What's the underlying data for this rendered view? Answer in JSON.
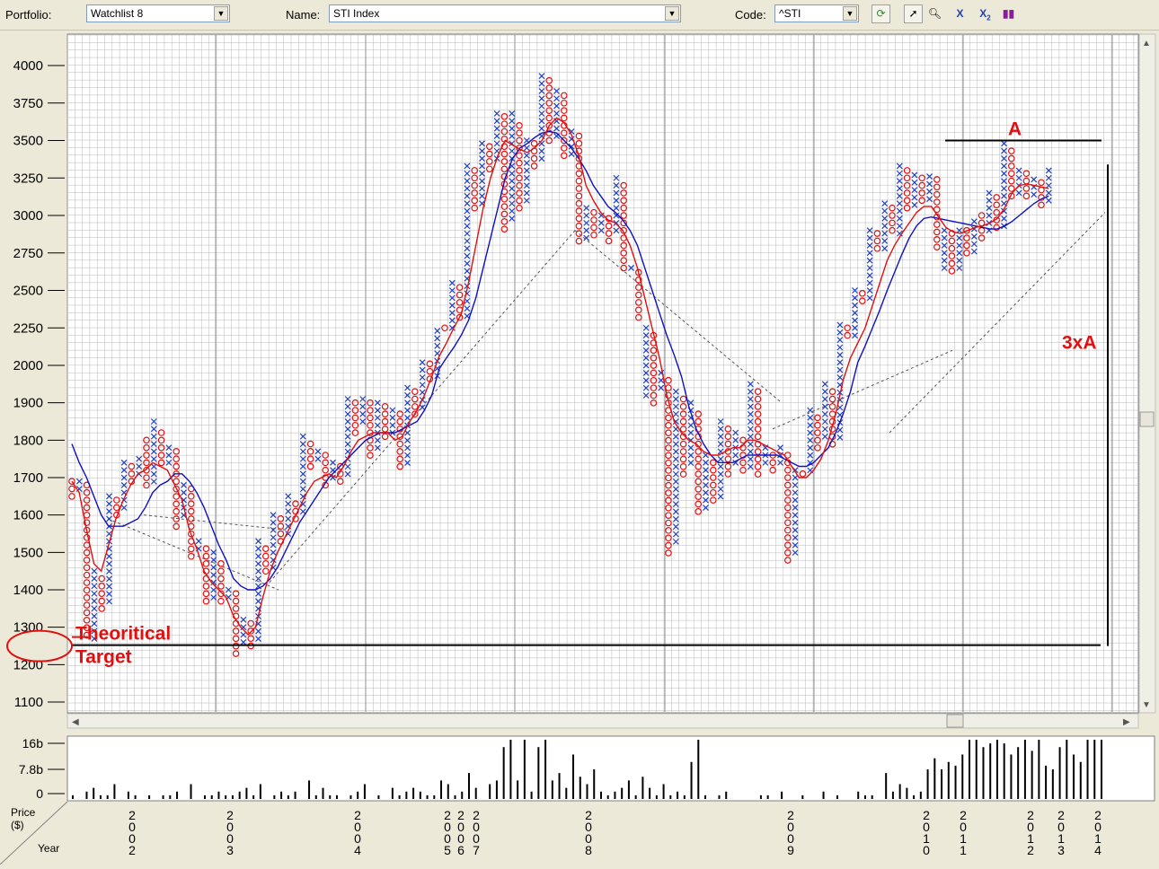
{
  "toolbar": {
    "portfolio_label": "Portfolio:",
    "portfolio_value": "Watchlist 8",
    "name_label": "Name:",
    "name_value": "STI Index",
    "code_label": "Code:",
    "code_value": "^STI",
    "tools": [
      "refresh-icon",
      "pointer-icon",
      "zoom-icon",
      "x-icon",
      "x2-icon",
      "bars-icon"
    ]
  },
  "colors": {
    "x_mark": "#1f3fbf",
    "o_mark": "#e01010",
    "fast_ma": "#e01010",
    "slow_ma": "#1010c0",
    "annotation": "#e01010",
    "grid": "#b8b8b8"
  },
  "chart_data": {
    "type": "point-and-figure",
    "y_ticks": [
      "4000",
      "3750",
      "3500",
      "3250",
      "3000",
      "2750",
      "2500",
      "2250",
      "2000",
      "1900",
      "1800",
      "1700",
      "1600",
      "1500",
      "1400",
      "1300",
      "1200",
      "1100"
    ],
    "y_tick_values": [
      4000,
      3750,
      3500,
      3250,
      3000,
      2750,
      2500,
      2250,
      2000,
      1900,
      1800,
      1700,
      1600,
      1500,
      1400,
      1300,
      1200,
      1100
    ],
    "annotations": {
      "target_label_line1": "Theoritical",
      "target_label_line2": "Target",
      "target_level": 1252,
      "measure_label": "A",
      "measure_level": 3500,
      "multiple_label": "3xA"
    },
    "columns": [
      {
        "t": "O",
        "lo": 1630,
        "hi": 1690
      },
      {
        "t": "X",
        "lo": 1650,
        "hi": 1690
      },
      {
        "t": "O",
        "lo": 1270,
        "hi": 1680
      },
      {
        "t": "X",
        "lo": 1260,
        "hi": 1450
      },
      {
        "t": "O",
        "lo": 1330,
        "hi": 1430
      },
      {
        "t": "X",
        "lo": 1350,
        "hi": 1650
      },
      {
        "t": "O",
        "lo": 1590,
        "hi": 1640
      },
      {
        "t": "X",
        "lo": 1600,
        "hi": 1740
      },
      {
        "t": "O",
        "lo": 1680,
        "hi": 1730
      },
      {
        "t": "X",
        "lo": 1690,
        "hi": 1750
      },
      {
        "t": "O",
        "lo": 1660,
        "hi": 1800
      },
      {
        "t": "X",
        "lo": 1680,
        "hi": 1850
      },
      {
        "t": "O",
        "lo": 1720,
        "hi": 1820
      },
      {
        "t": "X",
        "lo": 1730,
        "hi": 1780
      },
      {
        "t": "O",
        "lo": 1560,
        "hi": 1770
      },
      {
        "t": "X",
        "lo": 1590,
        "hi": 1680
      },
      {
        "t": "O",
        "lo": 1470,
        "hi": 1670
      },
      {
        "t": "X",
        "lo": 1490,
        "hi": 1530
      },
      {
        "t": "O",
        "lo": 1350,
        "hi": 1510
      },
      {
        "t": "X",
        "lo": 1370,
        "hi": 1500
      },
      {
        "t": "O",
        "lo": 1350,
        "hi": 1470
      },
      {
        "t": "X",
        "lo": 1360,
        "hi": 1400
      },
      {
        "t": "O",
        "lo": 1220,
        "hi": 1390
      },
      {
        "t": "X",
        "lo": 1240,
        "hi": 1320
      },
      {
        "t": "O",
        "lo": 1230,
        "hi": 1310
      },
      {
        "t": "X",
        "lo": 1250,
        "hi": 1530
      },
      {
        "t": "O",
        "lo": 1430,
        "hi": 1510
      },
      {
        "t": "X",
        "lo": 1450,
        "hi": 1600
      },
      {
        "t": "O",
        "lo": 1520,
        "hi": 1590
      },
      {
        "t": "X",
        "lo": 1530,
        "hi": 1650
      },
      {
        "t": "O",
        "lo": 1580,
        "hi": 1630
      },
      {
        "t": "X",
        "lo": 1600,
        "hi": 1810
      },
      {
        "t": "O",
        "lo": 1720,
        "hi": 1790
      },
      {
        "t": "X",
        "lo": 1730,
        "hi": 1770
      },
      {
        "t": "O",
        "lo": 1670,
        "hi": 1760
      },
      {
        "t": "X",
        "lo": 1690,
        "hi": 1740
      },
      {
        "t": "O",
        "lo": 1680,
        "hi": 1730
      },
      {
        "t": "X",
        "lo": 1700,
        "hi": 1910
      },
      {
        "t": "O",
        "lo": 1810,
        "hi": 1900
      },
      {
        "t": "X",
        "lo": 1830,
        "hi": 1910
      },
      {
        "t": "O",
        "lo": 1740,
        "hi": 1900
      },
      {
        "t": "X",
        "lo": 1760,
        "hi": 1900
      },
      {
        "t": "O",
        "lo": 1790,
        "hi": 1890
      },
      {
        "t": "X",
        "lo": 1810,
        "hi": 1880
      },
      {
        "t": "O",
        "lo": 1710,
        "hi": 1870
      },
      {
        "t": "X",
        "lo": 1730,
        "hi": 1940
      },
      {
        "t": "O",
        "lo": 1860,
        "hi": 1930
      },
      {
        "t": "X",
        "lo": 1880,
        "hi": 2020
      },
      {
        "t": "O",
        "lo": 1950,
        "hi": 2010
      },
      {
        "t": "X",
        "lo": 1970,
        "hi": 2230
      },
      {
        "t": "O",
        "lo": 2200,
        "hi": 2250
      },
      {
        "t": "X",
        "lo": 2220,
        "hi": 2550
      },
      {
        "t": "O",
        "lo": 2300,
        "hi": 2520
      },
      {
        "t": "X",
        "lo": 2320,
        "hi": 3330
      },
      {
        "t": "O",
        "lo": 3000,
        "hi": 3300
      },
      {
        "t": "X",
        "lo": 3050,
        "hi": 3480
      },
      {
        "t": "O",
        "lo": 3300,
        "hi": 3460
      },
      {
        "t": "X",
        "lo": 3330,
        "hi": 3680
      },
      {
        "t": "O",
        "lo": 2900,
        "hi": 3660
      },
      {
        "t": "X",
        "lo": 2950,
        "hi": 3680
      },
      {
        "t": "O",
        "lo": 3000,
        "hi": 3600
      },
      {
        "t": "X",
        "lo": 3050,
        "hi": 3500
      },
      {
        "t": "O",
        "lo": 3300,
        "hi": 3480
      },
      {
        "t": "X",
        "lo": 3330,
        "hi": 3930
      },
      {
        "t": "O",
        "lo": 3450,
        "hi": 3900
      },
      {
        "t": "X",
        "lo": 3480,
        "hi": 3830
      },
      {
        "t": "O",
        "lo": 3350,
        "hi": 3800
      },
      {
        "t": "X",
        "lo": 3380,
        "hi": 3560
      },
      {
        "t": "O",
        "lo": 2780,
        "hi": 3530
      },
      {
        "t": "X",
        "lo": 2810,
        "hi": 3050
      },
      {
        "t": "O",
        "lo": 2820,
        "hi": 3020
      },
      {
        "t": "X",
        "lo": 2850,
        "hi": 3000
      },
      {
        "t": "O",
        "lo": 2820,
        "hi": 2980
      },
      {
        "t": "X",
        "lo": 2850,
        "hi": 3250
      },
      {
        "t": "O",
        "lo": 2600,
        "hi": 3200
      },
      {
        "t": "X",
        "lo": 2620,
        "hi": 2650
      },
      {
        "t": "O",
        "lo": 2300,
        "hi": 2620
      },
      {
        "t": "X",
        "lo": 1900,
        "hi": 2250
      },
      {
        "t": "O",
        "lo": 1890,
        "hi": 2200
      },
      {
        "t": "X",
        "lo": 1920,
        "hi": 1980
      },
      {
        "t": "O",
        "lo": 1490,
        "hi": 1960
      },
      {
        "t": "X",
        "lo": 1510,
        "hi": 1930
      },
      {
        "t": "O",
        "lo": 1700,
        "hi": 1910
      },
      {
        "t": "X",
        "lo": 1720,
        "hi": 1900
      },
      {
        "t": "O",
        "lo": 1590,
        "hi": 1870
      },
      {
        "t": "X",
        "lo": 1610,
        "hi": 1760
      },
      {
        "t": "O",
        "lo": 1620,
        "hi": 1740
      },
      {
        "t": "X",
        "lo": 1640,
        "hi": 1850
      },
      {
        "t": "O",
        "lo": 1700,
        "hi": 1830
      },
      {
        "t": "X",
        "lo": 1720,
        "hi": 1820
      },
      {
        "t": "O",
        "lo": 1700,
        "hi": 1800
      },
      {
        "t": "X",
        "lo": 1720,
        "hi": 1950
      },
      {
        "t": "O",
        "lo": 1700,
        "hi": 1930
      },
      {
        "t": "X",
        "lo": 1720,
        "hi": 1780
      },
      {
        "t": "O",
        "lo": 1700,
        "hi": 1760
      },
      {
        "t": "X",
        "lo": 1720,
        "hi": 1780
      },
      {
        "t": "O",
        "lo": 1470,
        "hi": 1760
      },
      {
        "t": "X",
        "lo": 1490,
        "hi": 1720
      },
      {
        "t": "O",
        "lo": 1690,
        "hi": 1710
      },
      {
        "t": "X",
        "lo": 1710,
        "hi": 1880
      },
      {
        "t": "O",
        "lo": 1770,
        "hi": 1860
      },
      {
        "t": "X",
        "lo": 1790,
        "hi": 1950
      },
      {
        "t": "O",
        "lo": 1780,
        "hi": 1930
      },
      {
        "t": "X",
        "lo": 1800,
        "hi": 2270
      },
      {
        "t": "O",
        "lo": 2170,
        "hi": 2250
      },
      {
        "t": "X",
        "lo": 2190,
        "hi": 2500
      },
      {
        "t": "O",
        "lo": 2400,
        "hi": 2480
      },
      {
        "t": "X",
        "lo": 2420,
        "hi": 2900
      },
      {
        "t": "O",
        "lo": 2740,
        "hi": 2880
      },
      {
        "t": "X",
        "lo": 2760,
        "hi": 3080
      },
      {
        "t": "O",
        "lo": 2850,
        "hi": 3050
      },
      {
        "t": "X",
        "lo": 2870,
        "hi": 3330
      },
      {
        "t": "O",
        "lo": 3020,
        "hi": 3300
      },
      {
        "t": "X",
        "lo": 3050,
        "hi": 3270
      },
      {
        "t": "O",
        "lo": 3050,
        "hi": 3250
      },
      {
        "t": "X",
        "lo": 3070,
        "hi": 3260
      },
      {
        "t": "O",
        "lo": 2770,
        "hi": 3240
      },
      {
        "t": "X",
        "lo": 2600,
        "hi": 2900
      },
      {
        "t": "O",
        "lo": 2580,
        "hi": 2880
      },
      {
        "t": "X",
        "lo": 2600,
        "hi": 2900
      },
      {
        "t": "O",
        "lo": 2700,
        "hi": 2900
      },
      {
        "t": "X",
        "lo": 2750,
        "hi": 2960
      },
      {
        "t": "O",
        "lo": 2800,
        "hi": 3000
      },
      {
        "t": "X",
        "lo": 2850,
        "hi": 3150
      },
      {
        "t": "O",
        "lo": 2900,
        "hi": 3120
      },
      {
        "t": "X",
        "lo": 2920,
        "hi": 3480
      },
      {
        "t": "O",
        "lo": 3100,
        "hi": 3430
      },
      {
        "t": "X",
        "lo": 3130,
        "hi": 3300
      },
      {
        "t": "O",
        "lo": 3100,
        "hi": 3280
      },
      {
        "t": "X",
        "lo": 3130,
        "hi": 3240
      },
      {
        "t": "O",
        "lo": 3050,
        "hi": 3220
      },
      {
        "t": "X",
        "lo": 3070,
        "hi": 3300
      }
    ],
    "fast_ma": [
      1690,
      1660,
      1560,
      1470,
      1450,
      1520,
      1590,
      1640,
      1680,
      1710,
      1720,
      1740,
      1730,
      1720,
      1680,
      1640,
      1560,
      1510,
      1450,
      1420,
      1400,
      1380,
      1330,
      1300,
      1280,
      1300,
      1380,
      1450,
      1500,
      1540,
      1580,
      1620,
      1660,
      1690,
      1700,
      1710,
      1700,
      1730,
      1770,
      1800,
      1810,
      1820,
      1820,
      1820,
      1800,
      1810,
      1850,
      1880,
      1920,
      1970,
      2060,
      2150,
      2250,
      2340,
      2550,
      2800,
      3050,
      3250,
      3400,
      3500,
      3470,
      3440,
      3420,
      3450,
      3500,
      3600,
      3650,
      3620,
      3540,
      3400,
      3200,
      3100,
      3020,
      2970,
      2950,
      2900,
      2800,
      2650,
      2450,
      2250,
      2050,
      1920,
      1850,
      1820,
      1800,
      1790,
      1770,
      1760,
      1760,
      1770,
      1780,
      1780,
      1800,
      1800,
      1790,
      1780,
      1770,
      1760,
      1730,
      1700,
      1700,
      1720,
      1750,
      1800,
      1870,
      1960,
      2050,
      2150,
      2250,
      2400,
      2550,
      2700,
      2800,
      2880,
      2950,
      3020,
      3060,
      3060,
      2990,
      2920,
      2890,
      2880,
      2900,
      2920,
      2930,
      2950,
      2980,
      3050,
      3150,
      3200,
      3210,
      3200,
      3190,
      3180
    ],
    "slow_ma": [
      1790,
      1740,
      1700,
      1650,
      1600,
      1570,
      1570,
      1570,
      1580,
      1590,
      1620,
      1660,
      1680,
      1690,
      1710,
      1710,
      1690,
      1660,
      1620,
      1570,
      1520,
      1480,
      1430,
      1410,
      1400,
      1400,
      1410,
      1430,
      1460,
      1500,
      1540,
      1580,
      1610,
      1640,
      1670,
      1700,
      1720,
      1740,
      1760,
      1780,
      1800,
      1810,
      1820,
      1820,
      1820,
      1830,
      1840,
      1850,
      1880,
      1920,
      1990,
      2050,
      2120,
      2200,
      2300,
      2450,
      2650,
      2850,
      3050,
      3250,
      3380,
      3450,
      3480,
      3520,
      3550,
      3560,
      3550,
      3500,
      3450,
      3380,
      3300,
      3200,
      3130,
      3060,
      3020,
      2970,
      2900,
      2800,
      2650,
      2500,
      2350,
      2200,
      2070,
      1970,
      1890,
      1830,
      1790,
      1760,
      1740,
      1740,
      1740,
      1750,
      1760,
      1760,
      1760,
      1760,
      1760,
      1750,
      1740,
      1730,
      1730,
      1740,
      1760,
      1780,
      1820,
      1870,
      1930,
      2020,
      2130,
      2250,
      2370,
      2500,
      2620,
      2740,
      2850,
      2930,
      2980,
      2990,
      2980,
      2970,
      2960,
      2950,
      2940,
      2930,
      2920,
      2910,
      2910,
      2930,
      2960,
      3000,
      3040,
      3080,
      3110,
      3130
    ]
  },
  "volume": {
    "y_ticks": [
      "16b",
      "7.8b",
      "0"
    ],
    "bars": [
      1,
      0,
      2,
      3,
      1,
      1,
      4,
      0,
      2,
      1,
      0,
      1,
      0,
      1,
      1,
      2,
      0,
      4,
      0,
      1,
      1,
      2,
      1,
      1,
      2,
      3,
      1,
      4,
      0,
      1,
      2,
      1,
      2,
      0,
      5,
      1,
      3,
      1,
      1,
      0,
      1,
      2,
      4,
      0,
      1,
      0,
      3,
      1,
      2,
      3,
      2,
      1,
      1,
      5,
      4,
      1,
      2,
      7,
      3,
      0,
      4,
      5,
      14,
      16,
      5,
      16,
      2,
      14,
      16,
      5,
      7,
      3,
      12,
      6,
      4,
      8,
      2,
      1,
      2,
      3,
      5,
      1,
      6,
      3,
      1,
      4,
      1,
      2,
      1,
      10,
      16,
      1,
      0,
      1,
      2,
      0,
      0,
      0,
      0,
      1,
      1,
      0,
      2,
      0,
      0,
      1,
      0,
      0,
      2,
      0,
      1,
      0,
      0,
      2,
      1,
      1,
      0,
      7,
      2,
      4,
      3,
      1,
      2,
      8,
      11,
      8,
      10,
      9,
      12,
      16,
      16,
      14,
      15,
      16,
      15,
      12,
      14,
      16,
      13,
      16,
      9,
      8,
      14,
      16,
      12,
      10,
      16,
      16,
      16
    ]
  },
  "axis_footer": {
    "price_label": "Price",
    "price_unit": "($)",
    "year_label": "Year"
  },
  "years": [
    {
      "digits": [
        "2",
        "0",
        "0",
        "2"
      ]
    },
    {
      "digits": [
        "2",
        "0",
        "0",
        "3"
      ]
    },
    {
      "digits": [
        "2",
        "0",
        "0",
        "4"
      ]
    },
    {
      "digits": [
        "2",
        "0",
        "0",
        "5"
      ]
    },
    {
      "digits": [
        "2",
        "0",
        "0",
        "6"
      ]
    },
    {
      "digits": [
        "2",
        "0",
        "0",
        "7"
      ]
    },
    {
      "digits": [
        "2",
        "0",
        "0",
        "8"
      ]
    },
    {
      "digits": [
        "2",
        "0",
        "0",
        "9"
      ]
    },
    {
      "digits": [
        "2",
        "0",
        "1",
        "0"
      ]
    },
    {
      "digits": [
        "2",
        "0",
        "1",
        "1"
      ]
    },
    {
      "digits": [
        "2",
        "0",
        "1",
        "2"
      ]
    },
    {
      "digits": [
        "2",
        "0",
        "1",
        "3"
      ]
    },
    {
      "digits": [
        "2",
        "0",
        "1",
        "4"
      ]
    }
  ]
}
